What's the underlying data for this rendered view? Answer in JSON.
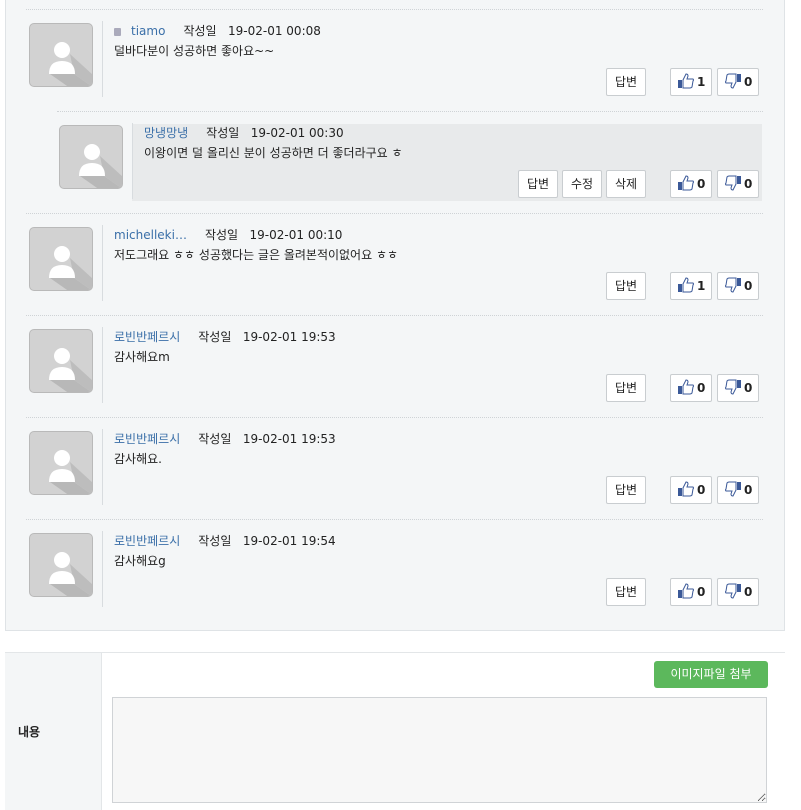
{
  "comments": [
    {
      "author": "tiamo",
      "date_label": "작성일",
      "date": "19-02-01 00:08",
      "body": "덜바다분이 성공하면 좋아요~~",
      "reply_label": "답변",
      "likes": "1",
      "dislikes": "0",
      "icon": "lock-icon"
    },
    {
      "author": "망냉망냉",
      "date_label": "작성일",
      "date": "19-02-01 00:30",
      "body": "이왕이면 덜 올리신 분이 성공하면 더 좋더라구요 ㅎ",
      "reply_label": "답변",
      "edit_label": "수정",
      "delete_label": "삭제",
      "likes": "0",
      "dislikes": "0",
      "is_reply": true
    },
    {
      "author": "michelleki…",
      "date_label": "작성일",
      "date": "19-02-01 00:10",
      "body": "저도그래요 ㅎㅎ 성공했다는 글은 올려본적이없어요 ㅎㅎ",
      "reply_label": "답변",
      "likes": "1",
      "dislikes": "0"
    },
    {
      "author": "로빈반페르시",
      "date_label": "작성일",
      "date": "19-02-01 19:53",
      "body": "감사해요m",
      "reply_label": "답변",
      "likes": "0",
      "dislikes": "0"
    },
    {
      "author": "로빈반페르시",
      "date_label": "작성일",
      "date": "19-02-01 19:53",
      "body": "감사해요.",
      "reply_label": "답변",
      "likes": "0",
      "dislikes": "0"
    },
    {
      "author": "로빈반페르시",
      "date_label": "작성일",
      "date": "19-02-01 19:54",
      "body": "감사해요g",
      "reply_label": "답변",
      "likes": "0",
      "dislikes": "0"
    }
  ],
  "form": {
    "content_label": "내용",
    "attach_label": "이미지파일 첨부",
    "textarea_placeholder": ""
  },
  "colors": {
    "author": "#3a6fa8",
    "attach_button": "#5cb85c",
    "panel_bg": "#f4f6f7"
  }
}
